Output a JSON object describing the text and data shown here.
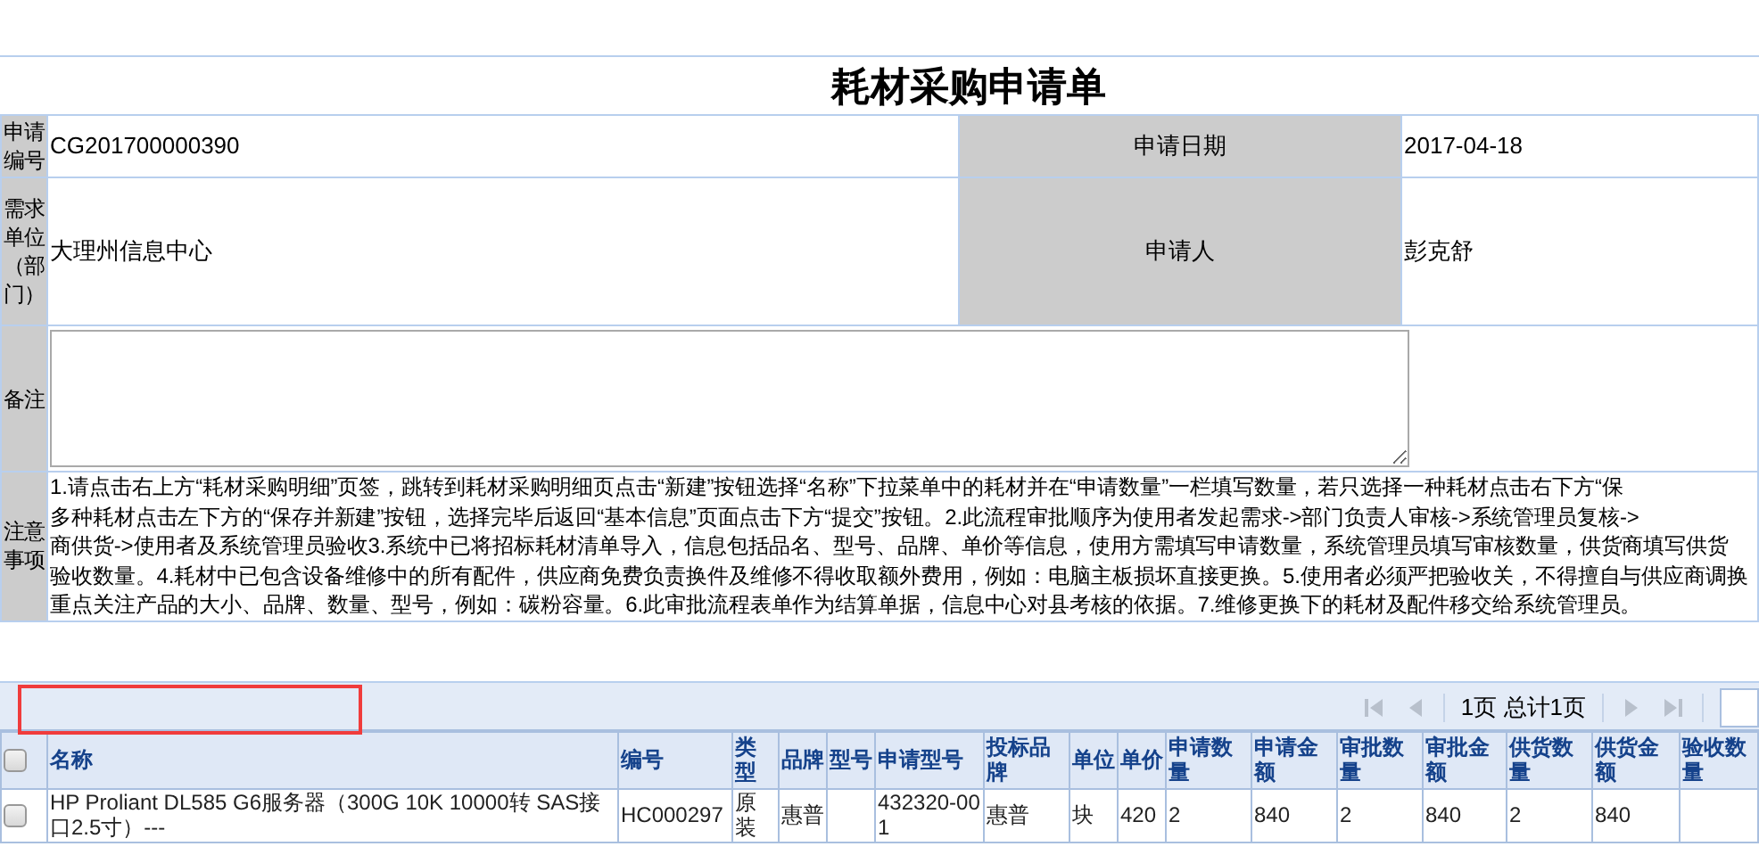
{
  "title": "耗材采购申请单",
  "form": {
    "rows": [
      {
        "cells": [
          {
            "label": "申请编号",
            "value": "CG201700000390"
          },
          {
            "label": "申请日期",
            "value": "2017-04-18"
          }
        ]
      },
      {
        "cells": [
          {
            "label": "需求单位（部门）",
            "value": "大理州信息中心"
          },
          {
            "label": "申请人",
            "value": "彭克舒"
          }
        ]
      }
    ],
    "remark": {
      "label": "备注"
    },
    "notes": {
      "label": "注意事项",
      "lines": [
        "1.请点击右上方“耗材采购明细”页签，跳转到耗材采购明细页点击“新建”按钮选择“名称”下拉菜单中的耗材并在“申请数量”一栏填写数量，若只选择一种耗材点击右下方“保",
        "多种耗材点击左下方的“保存并新建”按钮，选择完毕后返回“基本信息”页面点击下方“提交”按钮。2.此流程审批顺序为使用者发起需求->部门负责人审核->系统管理员复核->",
        "商供货->使用者及系统管理员验收3.系统中已将招标耗材清单导入，信息包括品名、型号、品牌、单价等信息，使用方需填写申请数量，系统管理员填写审核数量，供货商填写供货",
        "验收数量。4.耗材中已包含设备维修中的所有配件，供应商免费负责换件及维修不得收取额外费用，例如：电脑主板损坏直接更换。5.使用者必须严把验收关，不得擅自与供应商调换",
        "重点关注产品的大小、品牌、数量、型号，例如：碳粉容量。6.此审批流程表单作为结算单据，信息中心对县考核的依据。7.维修更换下的耗材及配件移交给系统管理员。"
      ]
    }
  },
  "pager": {
    "first_disabled": true,
    "prev_disabled": true,
    "page_text": "1页 总计1页",
    "next_disabled": true,
    "last_disabled": true
  },
  "grid": {
    "all_checked": false,
    "columns": [
      "名称",
      "编号",
      "类型",
      "品牌",
      "型号",
      "申请型号",
      "投标品牌",
      "单位",
      "单价",
      "申请数量",
      "申请金额",
      "审批数量",
      "审批金额",
      "供货数量",
      "供货金额",
      "验收数量"
    ],
    "rows": [
      {
        "checked": false,
        "cells": [
          "HP Proliant DL585 G6服务器（300G 10K 10000转 SAS接口2.5寸）---",
          "HC000297",
          "原装",
          "惠普",
          "",
          "432320-001",
          "惠普",
          "块",
          "420",
          "2",
          "840",
          "2",
          "840",
          "2",
          "840",
          ""
        ]
      }
    ]
  }
}
